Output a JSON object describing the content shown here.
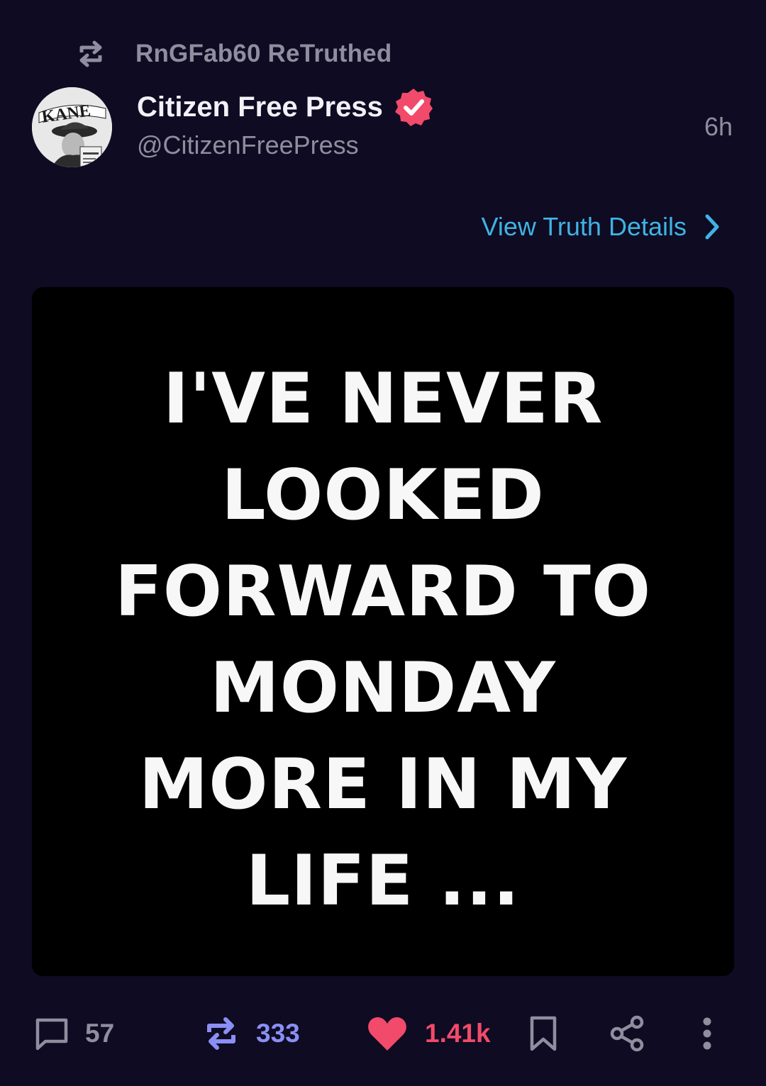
{
  "retruth": {
    "icon": "retruth-icon",
    "text": "RnGFab60 ReTruthed"
  },
  "author": {
    "avatar": "citizen-free-press-avatar",
    "avatar_text": "KANE",
    "name": "Citizen Free Press",
    "handle": "@CitizenFreePress",
    "verified_icon": "verified-badge-icon",
    "timestamp": "6h"
  },
  "details_link": {
    "label": "View Truth Details",
    "icon": "chevron-right-icon"
  },
  "media": {
    "lines": [
      "I'VE NEVER",
      "LOOKED",
      "FORWARD TO",
      "MONDAY",
      "MORE IN MY",
      "LIFE ..."
    ]
  },
  "actions": {
    "replies": {
      "icon": "comment-icon",
      "count": "57"
    },
    "retruths": {
      "icon": "retruth-icon",
      "count": "333"
    },
    "likes": {
      "icon": "heart-icon",
      "count": "1.41k"
    },
    "bookmark": {
      "icon": "bookmark-icon"
    },
    "share": {
      "icon": "share-icon"
    },
    "more": {
      "icon": "more-vertical-icon"
    }
  },
  "colors": {
    "background": "#0e0b22",
    "muted_text": "#8f8d9e",
    "link": "#3fb3e3",
    "verified": "#f24a6a",
    "retruth_accent": "#8a8ff4",
    "like_accent": "#f24a6a"
  }
}
